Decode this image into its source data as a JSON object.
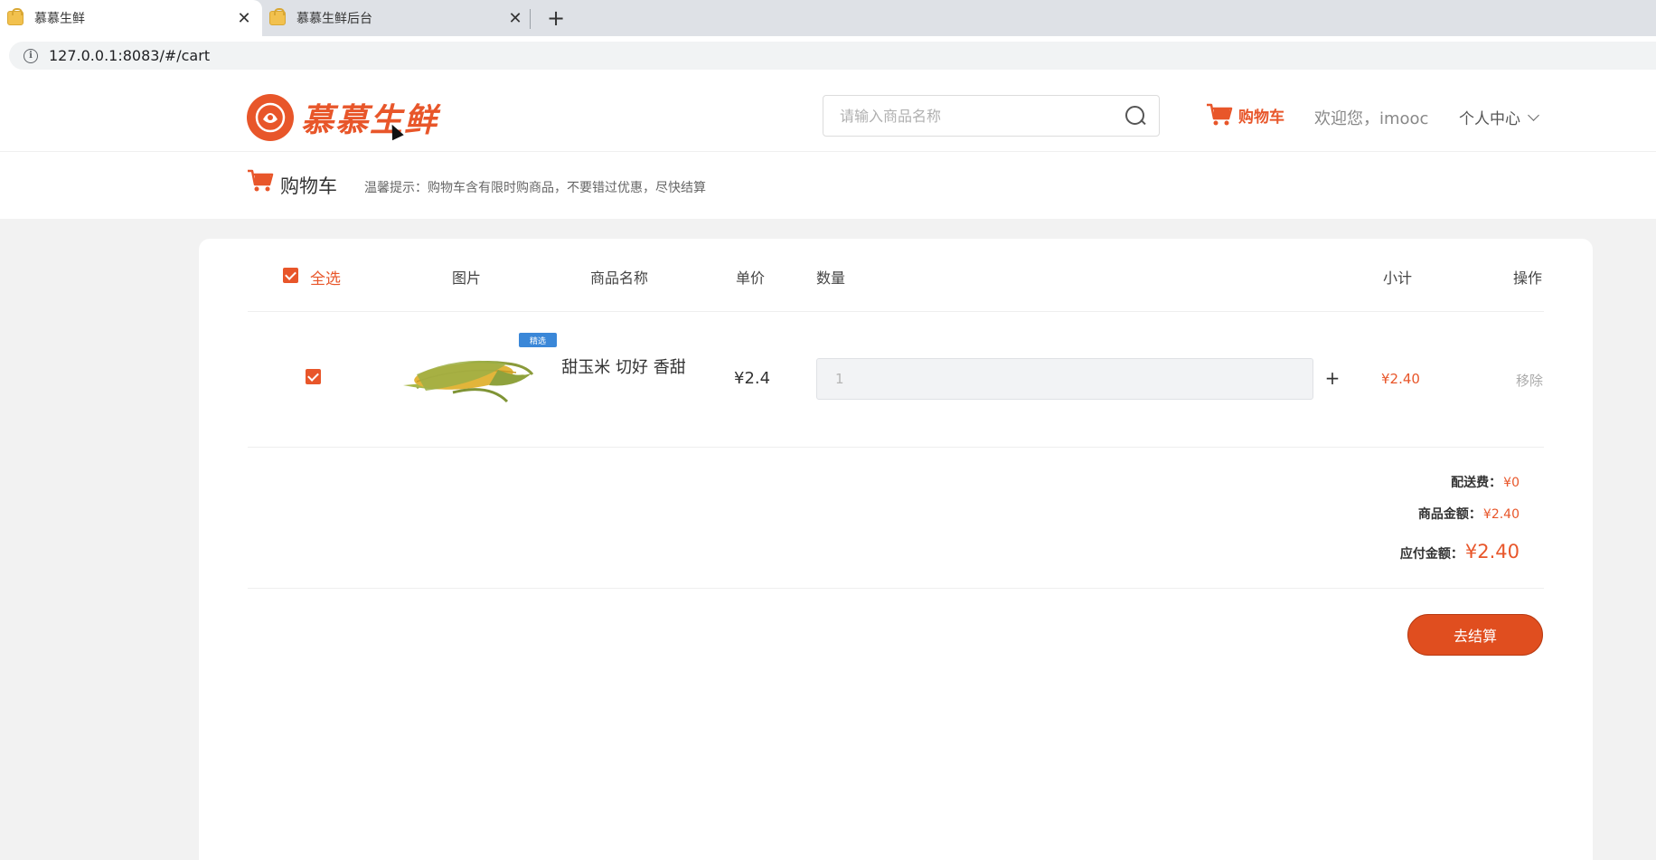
{
  "browser": {
    "tabs": [
      {
        "title": "慕慕生鲜",
        "active": true
      },
      {
        "title": "慕慕生鲜后台",
        "active": false
      }
    ],
    "new_tab_label": "+",
    "close_glyph": "✕",
    "url": "127.0.0.1:8083/#/cart"
  },
  "header": {
    "logo_text": "慕慕生鲜",
    "search_placeholder": "请输入商品名称",
    "cart_label": "购物车",
    "welcome": "欢迎您，imooc",
    "user_center": "个人中心"
  },
  "subheader": {
    "title": "购物车",
    "tip": "温馨提示：购物车含有限时购商品，不要错过优惠，尽快结算"
  },
  "cart": {
    "columns": {
      "select_all": "全选",
      "image": "图片",
      "name": "商品名称",
      "unit_price": "单价",
      "quantity": "数量",
      "subtotal": "小计",
      "action": "操作"
    },
    "items": [
      {
        "badge": "精选",
        "name": "甜玉米 切好 香甜",
        "unit_price": "¥2.4",
        "quantity": "1",
        "plus": "+",
        "subtotal": "¥2.40",
        "remove": "移除",
        "checked": true
      }
    ],
    "summary": {
      "shipping_label": "配送费：",
      "shipping_value": "¥0",
      "goods_label": "商品金额：",
      "goods_value": "¥2.40",
      "payable_label": "应付金额：",
      "payable_value": "¥2.40"
    },
    "checkout_label": "去结算"
  },
  "colors": {
    "accent": "#e8562a",
    "badge": "#3a87d8"
  }
}
